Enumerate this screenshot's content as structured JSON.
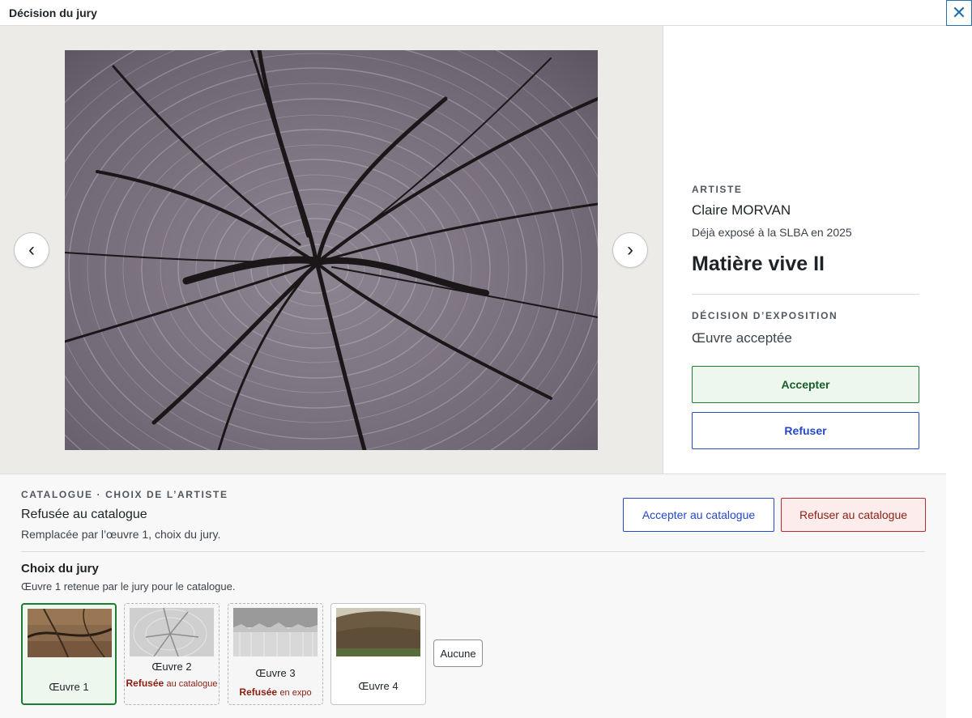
{
  "modal": {
    "title": "Décision du jury",
    "close_icon": "close-icon"
  },
  "viewer": {
    "prev_glyph": "‹",
    "next_glyph": "›"
  },
  "artist": {
    "label": "ARTISTE",
    "name": "Claire MORVAN",
    "note": "Déjà exposé à la SLBA en 2025",
    "work_title": "Matière vive II"
  },
  "exhibition": {
    "label": "DÉCISION D’EXPOSITION",
    "status": "Œuvre acceptée",
    "accept_label": "Accepter",
    "refuse_label": "Refuser"
  },
  "catalog": {
    "label": "CATALOGUE · CHOIX DE L’ARTISTE",
    "status": "Refusée au catalogue",
    "note": "Remplacée par l’œuvre 1, choix du jury.",
    "accept_label": "Accepter au catalogue",
    "refuse_label": "Refuser au catalogue"
  },
  "jury": {
    "title": "Choix du jury",
    "note": "Œuvre 1 retenue par le jury pour le catalogue.",
    "works": [
      {
        "label": "Œuvre 1",
        "state": "",
        "state_detail": "",
        "selected": true
      },
      {
        "label": "Œuvre 2",
        "state": "Refusée",
        "state_detail": "au catalogue",
        "selected": false
      },
      {
        "label": "Œuvre 3",
        "state": "Refusée",
        "state_detail": "en expo",
        "selected": false
      },
      {
        "label": "Œuvre 4",
        "state": "",
        "state_detail": "",
        "selected": false
      }
    ],
    "none_label": "Aucune"
  },
  "colors": {
    "accept_green": "#1e7b34",
    "refuse_red": "#b32d2e",
    "primary_blue": "#2547c9",
    "close_blue": "#2271b1"
  }
}
